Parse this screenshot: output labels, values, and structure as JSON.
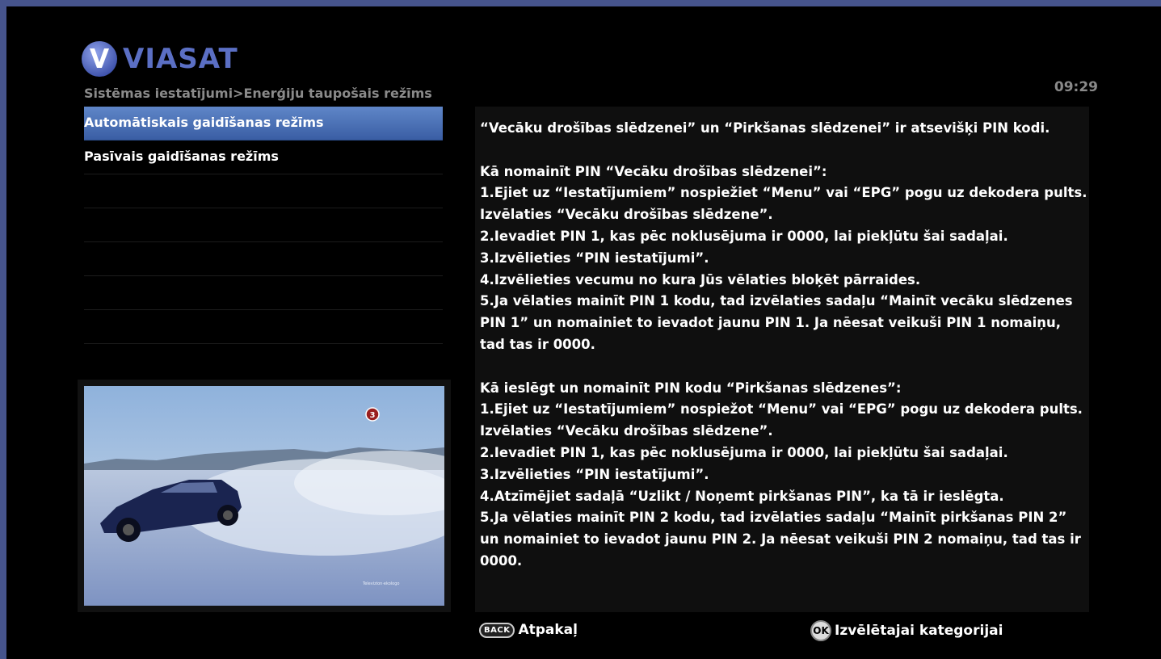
{
  "brand": {
    "name": "VIASAT",
    "color": "#5b6fc4",
    "icon": "viasat-v-logo"
  },
  "header": {
    "breadcrumb": "Sistēmas iestatījumi>Enerģiju taupošais režīms",
    "time": "09:29"
  },
  "menu": {
    "items": [
      {
        "label": "Automātiskais gaidīšanas režīms",
        "selected": true
      },
      {
        "label": "Pasīvais gaidīšanas režīms",
        "selected": false
      },
      {
        "label": ""
      },
      {
        "label": ""
      },
      {
        "label": ""
      },
      {
        "label": ""
      },
      {
        "label": ""
      },
      {
        "label": ""
      }
    ]
  },
  "preview": {
    "channel_badge": "3",
    "watermark": "Televizion·ekologo"
  },
  "info": {
    "intro": "“Vecāku drošības slēdzenei” un “Pirkšanas slēdzenei” ir atsevišķi PIN kodi.",
    "section1": "Kā nomainīt PIN “Vecāku drošības slēdzenei”:\n1.Ejiet uz “Iestatījumiem” nospiežiet “Menu” vai “EPG” pogu uz dekodera pults. Izvēlaties “Vecāku drošības slēdzene”.\n2.Ievadiet PIN 1, kas pēc noklusējuma ir 0000, lai piekļūtu šai sadaļai.\n3.Izvēlieties “PIN iestatījumi”.\n4.Izvēlieties vecumu no kura Jūs vēlaties bloķēt pārraides.\n5.Ja vēlaties mainīt PIN 1 kodu, tad izvēlaties sadaļu “Mainīt vecāku slēdzenes PIN 1” un nomainiet to ievadot jaunu PIN 1. Ja nēesat veikuši PIN 1 nomaiņu, tad tas ir 0000.",
    "section2": "Kā ieslēgt un nomainīt PIN kodu “Pirkšanas slēdzenes”:\n1.Ejiet uz “Iestatījumiem” nospiežot “Menu” vai “EPG” pogu uz dekodera pults. Izvēlaties “Vecāku drošības slēdzene”.\n2.Ievadiet PIN 1, kas pēc noklusējuma ir 0000, lai piekļūtu šai sadaļai.\n3.Izvēlieties “PIN iestatījumi”.\n4.Atzīmējiet sadaļā “Uzlikt / Noņemt pirkšanas PIN”, ka tā ir ieslēgta.\n5.Ja vēlaties mainīt PIN 2 kodu, tad izvēlaties sadaļu “Mainīt pirkšanas PIN 2” un nomainiet to ievadot jaunu PIN 2. Ja nēesat veikuši PIN 2 nomaiņu, tad tas ir 0000."
  },
  "footer": {
    "back_badge": "BACK",
    "back_label": "Atpakaļ",
    "ok_badge": "OK",
    "ok_label": "Izvēlētajai kategorijai"
  }
}
